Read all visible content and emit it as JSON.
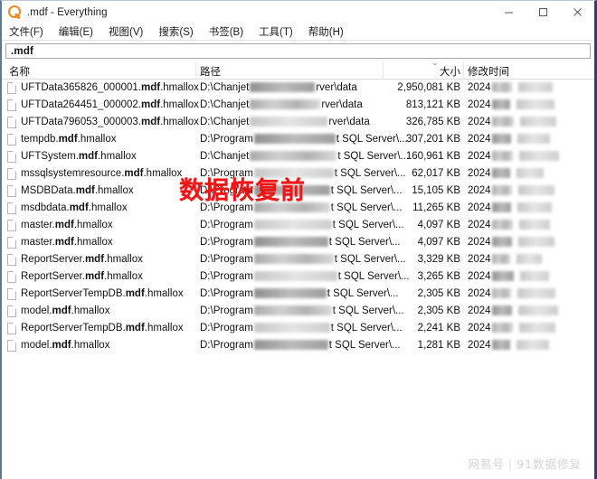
{
  "window": {
    "title": ".mdf - Everything",
    "icon": "everything-magnifier-icon",
    "controls": {
      "minimize": "minimize-button",
      "maximize": "maximize-button",
      "close": "close-button"
    }
  },
  "menubar": {
    "items": [
      {
        "label": "文件(F)"
      },
      {
        "label": "编辑(E)"
      },
      {
        "label": "视图(V)"
      },
      {
        "label": "搜索(S)"
      },
      {
        "label": "书签(B)"
      },
      {
        "label": "工具(T)"
      },
      {
        "label": "帮助(H)"
      }
    ]
  },
  "search": {
    "value": ".mdf",
    "placeholder": ""
  },
  "columns": [
    {
      "key": "name",
      "label": "名称"
    },
    {
      "key": "path",
      "label": "路径"
    },
    {
      "key": "size",
      "label": "大小",
      "sorted": "descending",
      "sort_glyph": "⌄"
    },
    {
      "key": "date",
      "label": "修改时间"
    }
  ],
  "rows": [
    {
      "name_main": "UFTData365826_000001.",
      "name_ext": "mdf",
      "name_tail": ".hmallox",
      "path_head": "D:\\Chanjet",
      "path_tail": "rver\\data",
      "size": "2,950,081 KB",
      "date": "2024"
    },
    {
      "name_main": "UFTData264451_000002.",
      "name_ext": "mdf",
      "name_tail": ".hmallox",
      "path_head": "D:\\Chanjet",
      "path_tail": "rver\\data",
      "size": "813,121 KB",
      "date": "2024"
    },
    {
      "name_main": "UFTData796053_000003.",
      "name_ext": "mdf",
      "name_tail": ".hmallox",
      "path_head": "D:\\Chanjet",
      "path_tail": "rver\\data",
      "size": "326,785 KB",
      "date": "2024"
    },
    {
      "name_main": "tempdb.",
      "name_ext": "mdf",
      "name_tail": ".hmallox",
      "path_head": "D:\\Program",
      "path_tail": "t SQL Server\\...",
      "size": "307,201 KB",
      "date": "2024"
    },
    {
      "name_main": "UFTSystem.",
      "name_ext": "mdf",
      "name_tail": ".hmallox",
      "path_head": "D:\\Chanjet",
      "path_tail": "t SQL Server\\...",
      "size": "160,961 KB",
      "date": "2024"
    },
    {
      "name_main": "mssqlsystemresource.",
      "name_ext": "mdf",
      "name_tail": ".hmallox",
      "path_head": "D:\\Program",
      "path_tail": "t SQL Server\\...",
      "size": "62,017 KB",
      "date": "2024"
    },
    {
      "name_main": "MSDBData.",
      "name_ext": "mdf",
      "name_tail": ".hmallox",
      "path_head": "D:\\Program",
      "path_tail": "t SQL Server\\...",
      "size": "15,105 KB",
      "date": "2024"
    },
    {
      "name_main": "msdbdata.",
      "name_ext": "mdf",
      "name_tail": ".hmallox",
      "path_head": "D:\\Program",
      "path_tail": "t SQL Server\\...",
      "size": "11,265 KB",
      "date": "2024"
    },
    {
      "name_main": "master.",
      "name_ext": "mdf",
      "name_tail": ".hmallox",
      "path_head": "D:\\Program",
      "path_tail": "t SQL Server\\...",
      "size": "4,097 KB",
      "date": "2024"
    },
    {
      "name_main": "master.",
      "name_ext": "mdf",
      "name_tail": ".hmallox",
      "path_head": "D:\\Program",
      "path_tail": "t SQL Server\\...",
      "size": "4,097 KB",
      "date": "2024"
    },
    {
      "name_main": "ReportServer.",
      "name_ext": "mdf",
      "name_tail": ".hmallox",
      "path_head": "D:\\Program",
      "path_tail": "t SQL Server\\...",
      "size": "3,329 KB",
      "date": "2024"
    },
    {
      "name_main": "ReportServer.",
      "name_ext": "mdf",
      "name_tail": ".hmallox",
      "path_head": "D:\\Program",
      "path_tail": "t SQL Server\\...",
      "size": "3,265 KB",
      "date": "2024"
    },
    {
      "name_main": "ReportServerTempDB.",
      "name_ext": "mdf",
      "name_tail": ".hmallox",
      "path_head": "D:\\Program",
      "path_tail": "t SQL Server\\...",
      "size": "2,305 KB",
      "date": "2024"
    },
    {
      "name_main": "model.",
      "name_ext": "mdf",
      "name_tail": ".hmallox",
      "path_head": "D:\\Program",
      "path_tail": "t SQL Server\\...",
      "size": "2,305 KB",
      "date": "2024"
    },
    {
      "name_main": "ReportServerTempDB.",
      "name_ext": "mdf",
      "name_tail": ".hmallox",
      "path_head": "D:\\Program",
      "path_tail": "t SQL Server\\...",
      "size": "2,241 KB",
      "date": "2024"
    },
    {
      "name_main": "model.",
      "name_ext": "mdf",
      "name_tail": ".hmallox",
      "path_head": "D:\\Program",
      "path_tail": "t SQL Server\\...",
      "size": "1,281 KB",
      "date": "2024"
    }
  ],
  "overlay": {
    "stamp_text": "数据恢复前"
  },
  "watermark": {
    "source": "网易号",
    "separator": "|",
    "account": "91数据修复"
  },
  "colors": {
    "stamp_red": "#f01414",
    "accent_orange": "#f08a1e",
    "border_blue": "#1f3f8f"
  }
}
